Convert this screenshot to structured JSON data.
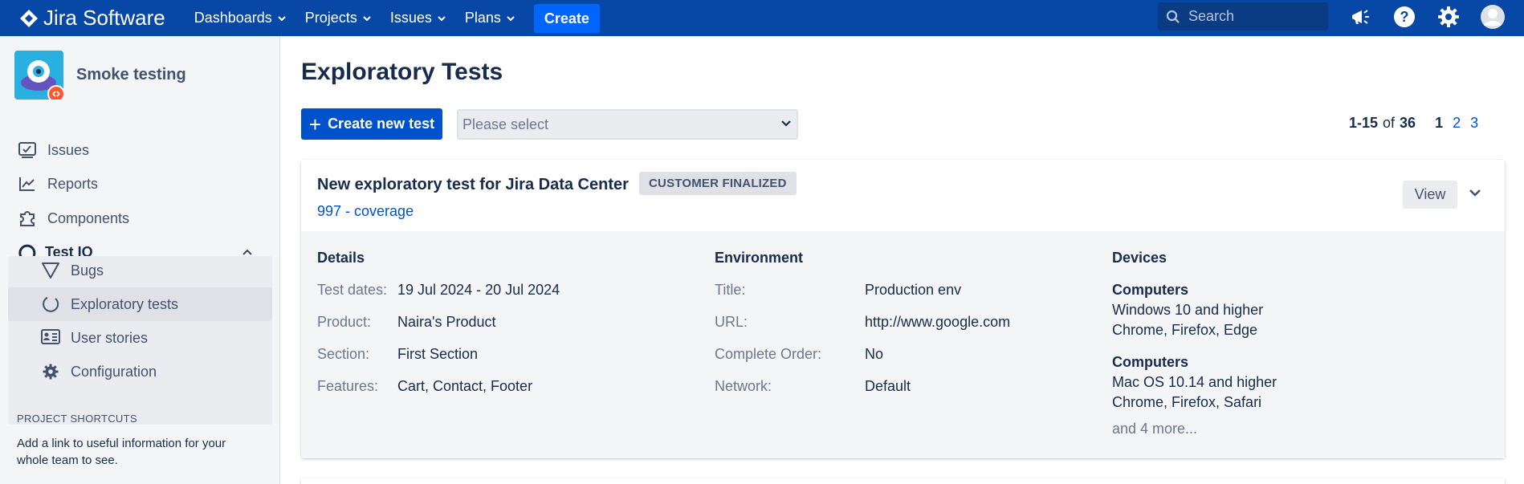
{
  "topbar": {
    "app_name": "Jira Software",
    "nav": [
      {
        "label": "Dashboards"
      },
      {
        "label": "Projects"
      },
      {
        "label": "Issues"
      },
      {
        "label": "Plans"
      }
    ],
    "create_label": "Create",
    "search_placeholder": "Search"
  },
  "sidebar": {
    "project_name": "Smoke testing",
    "items": [
      {
        "label": "Issues",
        "icon": "issues-icon"
      },
      {
        "label": "Reports",
        "icon": "reports-icon"
      },
      {
        "label": "Components",
        "icon": "puzzle-icon"
      },
      {
        "label": "Test IO",
        "icon": "testio-icon"
      }
    ],
    "sub_items": [
      {
        "label": "Bugs",
        "icon": "bug-triangle-icon"
      },
      {
        "label": "Exploratory tests",
        "icon": "circle-icon"
      },
      {
        "label": "User stories",
        "icon": "user-story-icon"
      },
      {
        "label": "Configuration",
        "icon": "gear-icon"
      }
    ],
    "shortcuts_title": "PROJECT SHORTCUTS",
    "shortcuts_text": "Add a link to useful information for your whole team to see."
  },
  "main": {
    "title": "Exploratory Tests",
    "create_button": "Create new test",
    "select_placeholder": "Please select",
    "pager": {
      "range": "1-15",
      "of": "of",
      "total": "36",
      "pages": [
        "1",
        "2",
        "3"
      ]
    },
    "card": {
      "title": "New exploratory test for Jira Data Center",
      "status": "CUSTOMER FINALIZED",
      "link": "997 - coverage",
      "view_label": "View",
      "details": {
        "title": "Details",
        "rows": [
          {
            "key": "Test dates:",
            "value": "19 Jul 2024 - 20 Jul 2024"
          },
          {
            "key": "Product:",
            "value": "Naira's Product"
          },
          {
            "key": "Section:",
            "value": "First Section"
          },
          {
            "key": "Features:",
            "value": "Cart, Contact, Footer"
          }
        ]
      },
      "environment": {
        "title": "Environment",
        "rows": [
          {
            "key": "Title:",
            "value": "Production env"
          },
          {
            "key": "URL:",
            "value": "http://www.google.com"
          },
          {
            "key": "Complete Order:",
            "value": "No"
          },
          {
            "key": "Network:",
            "value": "Default"
          }
        ]
      },
      "devices": {
        "title": "Devices",
        "groups": [
          {
            "heading": "Computers",
            "os": "Windows 10 and higher",
            "browsers": "Chrome, Firefox, Edge"
          },
          {
            "heading": "Computers",
            "os": "Mac OS 10.14 and higher",
            "browsers": "Chrome, Firefox, Safari"
          }
        ],
        "more": "and 4 more..."
      }
    }
  },
  "colors": {
    "topbar": "#0747a6",
    "primary": "#0052cc",
    "create": "#0065ff",
    "sidebar_bg": "#f4f5f7"
  }
}
